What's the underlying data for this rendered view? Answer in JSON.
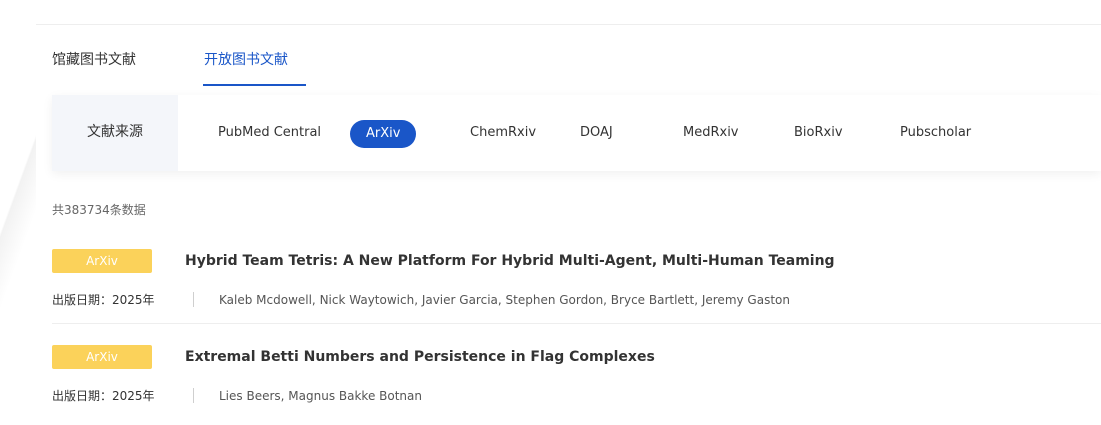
{
  "tabs": [
    {
      "label": "馆藏图书文献",
      "active": false
    },
    {
      "label": "开放图书文献",
      "active": true
    }
  ],
  "source_filter": {
    "label": "文献来源",
    "options": [
      "PubMed Central",
      "ArXiv",
      "ChemRxiv",
      "DOAJ",
      "MedRxiv",
      "BioRxiv",
      "Pubscholar"
    ],
    "selected": "ArXiv"
  },
  "result_count_text": "共383734条数据",
  "items": [
    {
      "badge": "ArXiv",
      "title": "Hybrid Team Tetris: A New Platform For Hybrid Multi-Agent, Multi-Human Teaming",
      "date": "出版日期：2025年",
      "authors": "Kaleb Mcdowell, Nick Waytowich, Javier Garcia, Stephen Gordon, Bryce Bartlett, Jeremy Gaston"
    },
    {
      "badge": "ArXiv",
      "title": "Extremal Betti Numbers and Persistence in Flag Complexes",
      "date": "出版日期：2025年",
      "authors": "Lies Beers, Magnus Bakke Botnan"
    }
  ],
  "colors": {
    "accent": "#1a56c8",
    "badge": "#fbd25a",
    "label_bg": "#f4f6fa"
  }
}
